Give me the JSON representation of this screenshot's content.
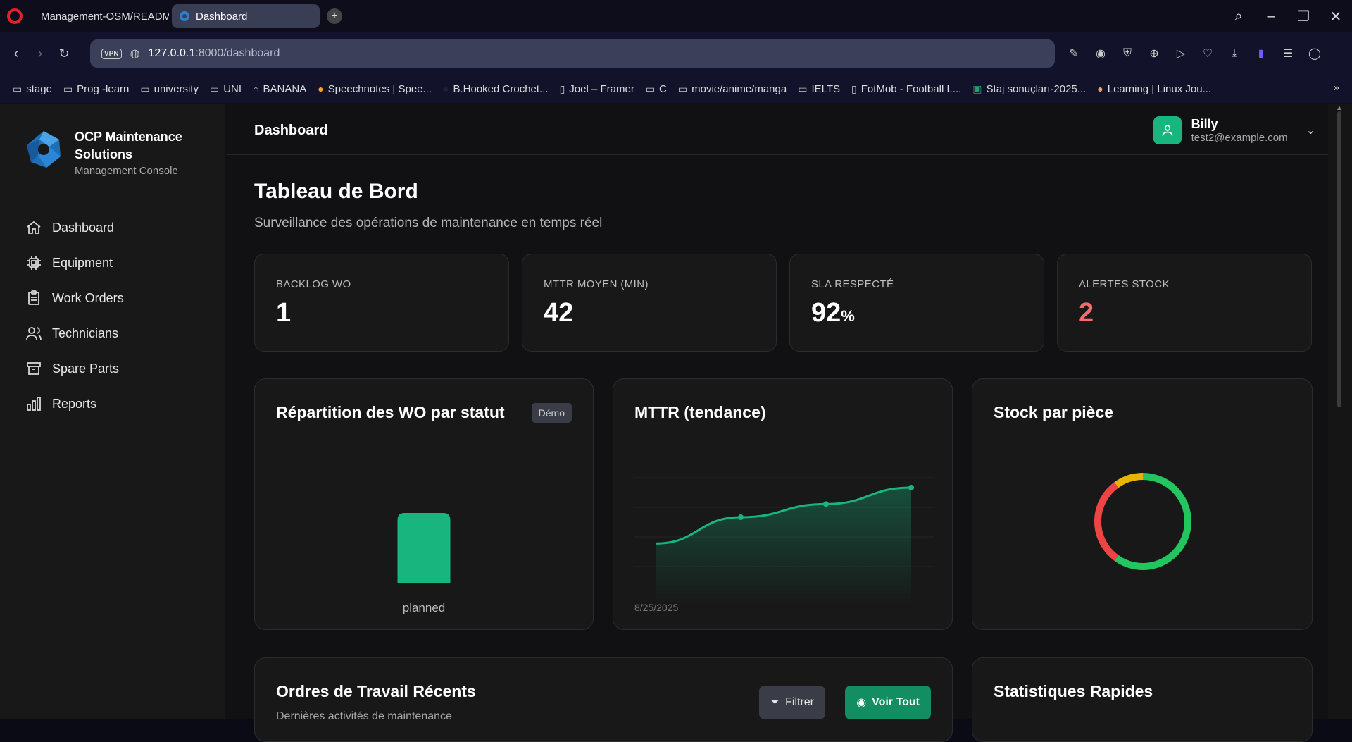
{
  "browser": {
    "tabs": [
      {
        "label": "Management-OSM/README"
      },
      {
        "label": "Dashboard"
      }
    ],
    "url_host": "127.0.0.1",
    "url_path": ":8000/dashboard",
    "vpn": "VPN",
    "bookmarks": [
      {
        "label": "stage",
        "icon": "folder-icon"
      },
      {
        "label": "Prog -learn",
        "icon": "folder-icon"
      },
      {
        "label": "university",
        "icon": "folder-icon"
      },
      {
        "label": "UNI",
        "icon": "folder-icon"
      },
      {
        "label": "BANANA",
        "icon": "bank-icon"
      },
      {
        "label": "Speechnotes | Spee...",
        "icon": "mic-icon"
      },
      {
        "label": "B.Hooked Crochet...",
        "icon": "site-icon"
      },
      {
        "label": "Joel – Framer",
        "icon": "page-icon"
      },
      {
        "label": "C",
        "icon": "folder-icon"
      },
      {
        "label": "movie/anime/manga",
        "icon": "folder-icon"
      },
      {
        "label": "IELTS",
        "icon": "folder-icon"
      },
      {
        "label": "FotMob - Football L...",
        "icon": "page-icon"
      },
      {
        "label": "Staj sonuçları-2025...",
        "icon": "sheet-icon"
      },
      {
        "label": "Learning | Linux Jou...",
        "icon": "site-icon"
      }
    ]
  },
  "sidebar": {
    "brand_name": "OCP Maintenance Solutions",
    "brand_sub": "Management Console",
    "items": [
      {
        "label": "Dashboard",
        "icon": "home-icon"
      },
      {
        "label": "Equipment",
        "icon": "chip-icon"
      },
      {
        "label": "Work Orders",
        "icon": "clipboard-icon"
      },
      {
        "label": "Technicians",
        "icon": "users-icon"
      },
      {
        "label": "Spare Parts",
        "icon": "archive-icon"
      },
      {
        "label": "Reports",
        "icon": "bar-chart-icon"
      }
    ]
  },
  "header": {
    "title": "Dashboard",
    "user_name": "Billy",
    "user_email": "test2@example.com"
  },
  "main": {
    "title": "Tableau de Bord",
    "subtitle": "Surveillance des opérations de maintenance en temps réel",
    "kpis": [
      {
        "label": "BACKLOG WO",
        "value": "1",
        "unit": "",
        "color": "#ffffff"
      },
      {
        "label": "MTTR MOYEN (MIN)",
        "value": "42",
        "unit": "",
        "color": "#ffffff"
      },
      {
        "label": "SLA RESPECTÉ",
        "value": "92",
        "unit": "%",
        "color": "#ffffff"
      },
      {
        "label": "ALERTES STOCK",
        "value": "2",
        "unit": "",
        "color": "#f26d6d"
      }
    ],
    "chart_cards": [
      {
        "title": "Répartition des WO par statut",
        "badge": "Démo"
      },
      {
        "title": "MTTR (tendance)"
      },
      {
        "title": "Stock par pièce"
      }
    ],
    "recent": {
      "title": "Ordres de Travail Récents",
      "subtitle": "Dernières activités de maintenance",
      "filter_label": "Filtrer",
      "view_all_label": "Voir Tout"
    },
    "quick_stats": {
      "title": "Statistiques Rapides"
    }
  },
  "colors": {
    "accent": "#18b57f",
    "danger": "#ef4444",
    "warning": "#eab308",
    "success": "#22c55e"
  },
  "chart_data": [
    {
      "type": "bar",
      "categories": [
        "planned"
      ],
      "values": [
        1
      ],
      "title": "Répartition des WO par statut"
    },
    {
      "type": "area",
      "x": [
        "8/25/2025"
      ],
      "series": [
        {
          "values": [
            30,
            38,
            42,
            47
          ]
        }
      ],
      "title": "MTTR (tendance)"
    },
    {
      "type": "pie",
      "title": "Stock par pièce",
      "slices": [
        {
          "value": 60,
          "color": "#22c55e"
        },
        {
          "value": 30,
          "color": "#ef4444"
        },
        {
          "value": 10,
          "color": "#eab308"
        }
      ]
    }
  ]
}
